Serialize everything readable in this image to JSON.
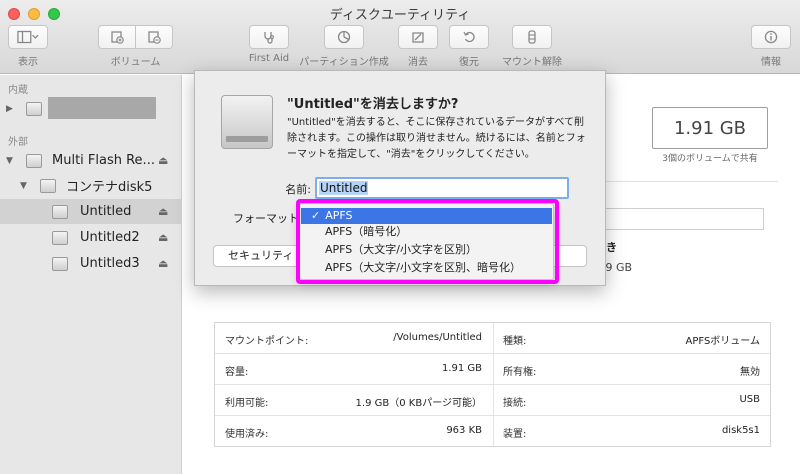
{
  "window": {
    "title": "ディスクユーティリティ"
  },
  "toolbar": {
    "view_label": "表示",
    "volume_label": "ボリューム",
    "first_aid_label": "First Aid",
    "partition_label": "パーティション作成",
    "erase_label": "消去",
    "restore_label": "復元",
    "unmount_label": "マウント解除",
    "info_label": "情報"
  },
  "sidebar": {
    "internal_label": "内蔵",
    "external_label": "外部",
    "items": [
      {
        "label": "Multi Flash Re..."
      },
      {
        "label": "コンテナdisk5"
      },
      {
        "label": "Untitled"
      },
      {
        "label": "Untitled2"
      },
      {
        "label": "Untitled3"
      }
    ]
  },
  "summary": {
    "size": "1.91 GB",
    "size_sub": "3個のボリュームで共有",
    "available_label": "空き",
    "available_value": "1.9 GB"
  },
  "info_table": {
    "rows": [
      {
        "left_label": "マウントポイント:",
        "left_value": "/Volumes/Untitled",
        "right_label": "種類:",
        "right_value": "APFSボリューム"
      },
      {
        "left_label": "容量:",
        "left_value": "1.91 GB",
        "right_label": "所有権:",
        "right_value": "無効"
      },
      {
        "left_label": "利用可能:",
        "left_value": "1.9 GB（0 KBパージ可能）",
        "right_label": "接続:",
        "right_value": "USB"
      },
      {
        "left_label": "使用済み:",
        "left_value": "963 KB",
        "right_label": "装置:",
        "right_value": "disk5s1"
      }
    ]
  },
  "sheet": {
    "title": "\"Untitled\"を消去しますか?",
    "description": "\"Untitled\"を消去すると、そこに保存されているデータがすべて削除されます。この操作は取り消せません。続けるには、名前とフォーマットを指定して、\"消去\"をクリックしてください。",
    "name_label": "名前:",
    "name_value": "Untitled",
    "format_label": "フォーマット",
    "security_label": "セキュリティ"
  },
  "format_menu": {
    "check": "✓",
    "options": [
      "APFS",
      "APFS（暗号化）",
      "APFS（大文字/小文字を区別）",
      "APFS（大文字/小文字を区別、暗号化）"
    ],
    "selected_index": 0
  },
  "colors": {
    "accent": "#3c75e6",
    "highlight": "#ff00ff"
  }
}
